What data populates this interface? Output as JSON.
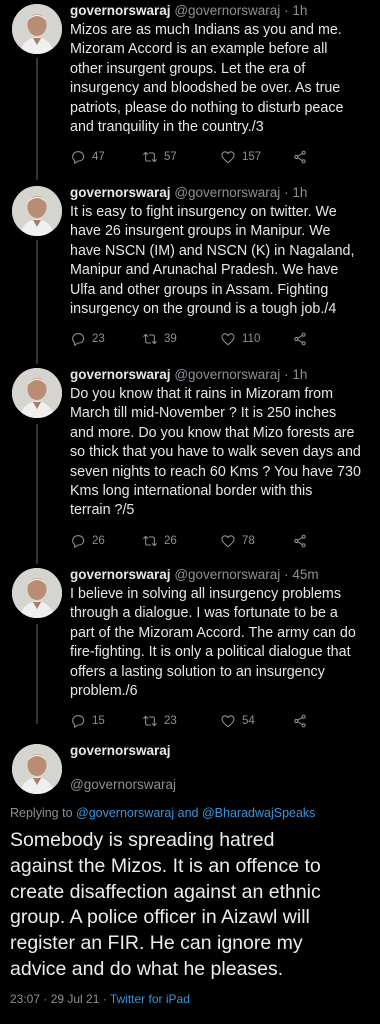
{
  "tweets": [
    {
      "name": "governorswaraj",
      "handle": "@governorswaraj",
      "sep": " · ",
      "time": "1h",
      "lines": [
        "Mizos are as much Indians as you and me.",
        "Mizoram Accord is an example before all",
        "other insurgent groups. Let the era of",
        "insurgency and bloodshed  be over. As true",
        "patriots, please do nothing to disturb peace",
        "and tranquility in the country./3"
      ],
      "replies": "47",
      "retweets": "57",
      "likes": "157"
    },
    {
      "name": "governorswaraj",
      "handle": "@governorswaraj",
      "sep": " · ",
      "time": "1h",
      "lines": [
        "It is easy to fight insurgency on twitter. We",
        "have 26 insurgent groups in Manipur. We",
        "have NSCN (IM) and NSCN (K) in Nagaland,",
        "Manipur and Arunachal Pradesh. We have",
        "Ulfa and other groups in Assam. Fighting",
        "insurgency on the ground is a tough job./4"
      ],
      "replies": "23",
      "retweets": "39",
      "likes": "110"
    },
    {
      "name": "governorswaraj",
      "handle": "@governorswaraj",
      "sep": " · ",
      "time": "1h",
      "lines": [
        "Do you know that it rains in Mizoram from",
        "March till mid-November ? It is 250 inches",
        "and more. Do you know that Mizo forests are",
        "so thick that you have to walk seven days and",
        "seven nights to reach 60 Kms ? You have 730",
        "Kms long international border with this",
        "terrain ?/5"
      ],
      "replies": "26",
      "retweets": "26",
      "likes": "78"
    },
    {
      "name": "governorswaraj",
      "handle": "@governorswaraj",
      "sep": " · ",
      "time": "45m",
      "lines": [
        "I believe in solving all insurgency problems",
        "through a dialogue. I was fortunate to be a",
        "part of the Mizoram Accord. The army can do",
        "fire-fighting. It is only a political dialogue that",
        "offers a lasting solution to an insurgency",
        "problem./6"
      ],
      "replies": "15",
      "retweets": "23",
      "likes": "54"
    }
  ],
  "main": {
    "name": "governorswaraj",
    "handle": "@governorswaraj",
    "replying_prefix": "Replying to ",
    "replying_user1": "@governorswaraj",
    "replying_and": " and ",
    "replying_user2": "@BharadwajSpeaks",
    "lines": [
      "Somebody is spreading hatred",
      "against the Mizos. It is an offence to",
      "create disaffection against an ethnic",
      "group. A police officer in Aizawl will",
      "register an FIR. He can ignore my",
      "advice and do what he pleases."
    ],
    "timestamp": "23:07 · 29 Jul 21 · ",
    "source": "Twitter for iPad"
  },
  "icons": {
    "reply": "reply-icon",
    "retweet": "retweet-icon",
    "like": "heart-icon",
    "share": "share-icon"
  },
  "colors": {
    "background": "#000000",
    "link": "#3a94d8",
    "muted": "#8b9096"
  }
}
